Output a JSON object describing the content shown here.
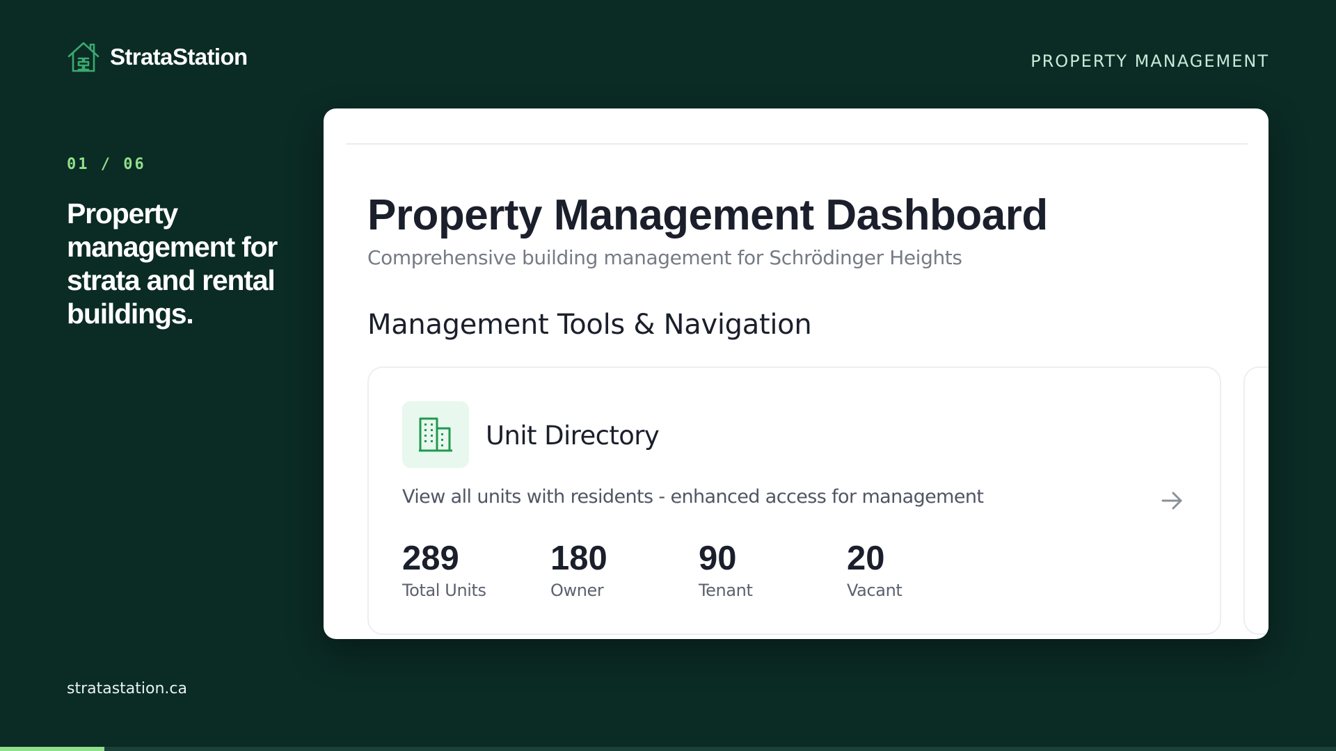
{
  "brand": {
    "name": "StrataStation",
    "logo_icon": "house-logo-icon",
    "accent_color": "#3aaa6e"
  },
  "header": {
    "category_label": "PROPERTY MANAGEMENT"
  },
  "slide": {
    "counter": "01 / 06",
    "headline": "Property management for strata and rental buildings.",
    "progress": 0.078
  },
  "footer": {
    "url": "stratastation.ca"
  },
  "dashboard": {
    "title": "Property Management Dashboard",
    "subtitle": "Comprehensive building management for Schrödinger Heights",
    "section_heading": "Management Tools & Navigation",
    "tool_card": {
      "icon": "building-icon",
      "title": "Unit Directory",
      "description": "View all units with residents - enhanced access for management",
      "action_icon": "arrow-right-icon",
      "stats": [
        {
          "value": "289",
          "label": "Total Units"
        },
        {
          "value": "180",
          "label": "Owner"
        },
        {
          "value": "90",
          "label": "Tenant"
        },
        {
          "value": "20",
          "label": "Vacant"
        }
      ]
    }
  },
  "colors": {
    "background": "#0b2b25",
    "accent_green": "#8fe08a",
    "icon_green": "#1f9a4f"
  }
}
